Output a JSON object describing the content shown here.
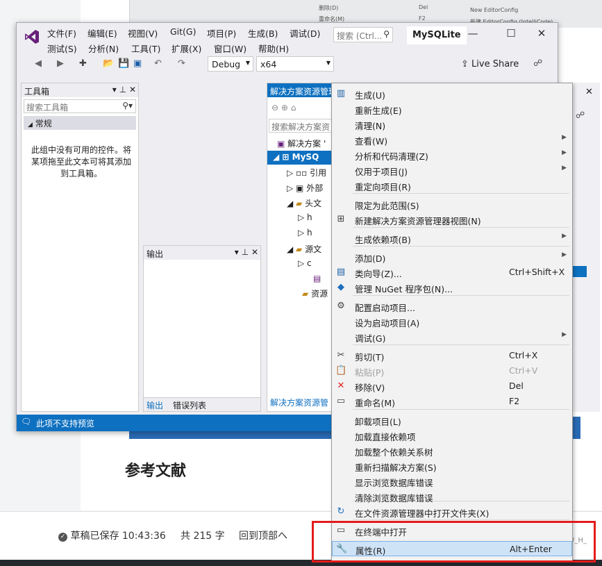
{
  "background": {
    "heading": "参考文献",
    "status_saved": "草稿已保存 10:43:36",
    "word_count": "共 215 字",
    "back_to_top": "回到顶部へ",
    "watermark": "CSDN @Z_W_H_",
    "peek_items": [
      "删除(D)",
      "Del",
      "重命名(M)",
      "F2",
      "New EditorConfig",
      "新建 EditorConfig (IntelliCode)"
    ]
  },
  "vs": {
    "menu_row1": [
      "文件(F)",
      "编辑(E)",
      "视图(V)",
      "Git(G)",
      "项目(P)",
      "生成(B)",
      "调试(D)"
    ],
    "menu_row2": [
      "测试(S)",
      "分析(N)",
      "工具(T)",
      "扩展(X)",
      "窗口(W)",
      "帮助(H)"
    ],
    "search_placeholder": "搜索 (Ctrl...",
    "app_name": "MySQLite",
    "config": "Debug",
    "platform": "x64",
    "live_share": "Live Share",
    "toolbox": {
      "title": "工具箱",
      "search_placeholder": "搜索工具箱",
      "group": "常规",
      "empty_message": "此组中没有可用的控件。将某项拖至此文本可将其添加到工具箱。"
    },
    "output": {
      "title": "输出",
      "tabs": [
        "输出",
        "错误列表"
      ]
    },
    "solution_explorer": {
      "title": "解决方案资源管理",
      "search_placeholder": "搜索解决方案资",
      "tree": [
        "解决方案 '",
        "MySQ",
        "引用",
        "外部",
        "头文",
        "",
        "",
        "源文",
        "",
        "",
        "资源"
      ],
      "footer_tab": "解决方案资源管"
    },
    "status_footer": "此项不支持预览"
  },
  "context_menu": {
    "items": [
      {
        "label": "生成(U)",
        "icon": "build-icon"
      },
      {
        "label": "重新生成(E)"
      },
      {
        "label": "清理(N)"
      },
      {
        "label": "查看(W)",
        "submenu": true
      },
      {
        "label": "分析和代码清理(Z)",
        "submenu": true
      },
      {
        "label": "仅用于项目(J)",
        "submenu": true
      },
      {
        "label": "重定向项目(R)"
      },
      {
        "label": "限定为此范围(S)"
      },
      {
        "label": "新建解决方案资源管理器视图(N)",
        "icon": "new-view-icon"
      },
      {
        "label": "生成依赖项(B)",
        "submenu": true
      },
      {
        "label": "添加(D)",
        "submenu": true
      },
      {
        "label": "类向导(Z)...",
        "shortcut": "Ctrl+Shift+X",
        "icon": "class-wizard-icon"
      },
      {
        "label": "管理 NuGet 程序包(N)...",
        "icon": "nuget-icon"
      },
      {
        "label": "配置启动项目...",
        "icon": "gear-icon"
      },
      {
        "label": "设为启动项目(A)"
      },
      {
        "label": "调试(G)",
        "submenu": true
      },
      {
        "label": "剪切(T)",
        "shortcut": "Ctrl+X",
        "icon": "scissors-icon"
      },
      {
        "label": "粘贴(P)",
        "shortcut": "Ctrl+V",
        "icon": "paste-icon",
        "disabled": true
      },
      {
        "label": "移除(V)",
        "shortcut": "Del",
        "icon": "remove-icon"
      },
      {
        "label": "重命名(M)",
        "shortcut": "F2",
        "icon": "rename-icon"
      },
      {
        "label": "卸载项目(L)"
      },
      {
        "label": "加载直接依赖项"
      },
      {
        "label": "加载整个依赖关系树"
      },
      {
        "label": "重新扫描解决方案(S)"
      },
      {
        "label": "显示浏览数据库错误"
      },
      {
        "label": "清除浏览数据库错误"
      },
      {
        "label": "在文件资源管理器中打开文件夹(X)",
        "icon": "open-folder-icon"
      },
      {
        "label": "在终端中打开",
        "icon": "terminal-icon"
      },
      {
        "label": "属性(R)",
        "shortcut": "Alt+Enter",
        "icon": "wrench-icon",
        "highlighted": true
      }
    ]
  }
}
